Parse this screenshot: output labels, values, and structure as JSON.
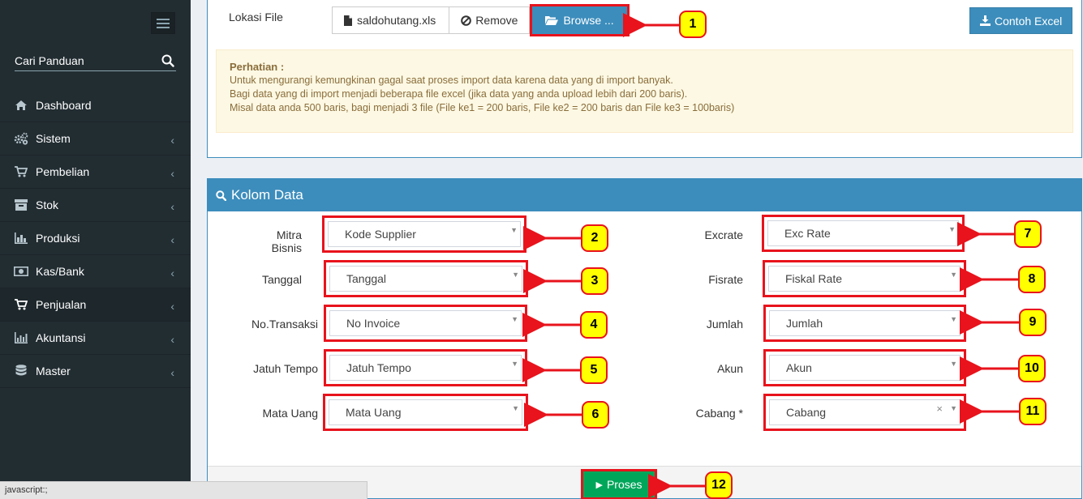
{
  "sidebar": {
    "search_placeholder": "Cari Panduan",
    "items": [
      {
        "label": "Dashboard",
        "icon": "home-icon"
      },
      {
        "label": "Sistem",
        "icon": "gears-icon"
      },
      {
        "label": "Pembelian",
        "icon": "cart-icon"
      },
      {
        "label": "Stok",
        "icon": "archive-icon"
      },
      {
        "label": "Produksi",
        "icon": "bar-chart-icon"
      },
      {
        "label": "Kas/Bank",
        "icon": "money-icon"
      },
      {
        "label": "Penjualan",
        "icon": "cart-icon"
      },
      {
        "label": "Akuntansi",
        "icon": "line-chart-icon"
      },
      {
        "label": "Master",
        "icon": "database-icon"
      }
    ]
  },
  "upload": {
    "label": "Lokasi File",
    "file_name": "saldohutang.xls",
    "remove_label": "Remove",
    "browse_label": "Browse ...",
    "contoh_label": "Contoh Excel"
  },
  "alert": {
    "title": "Perhatian :",
    "line1": "Untuk mengurangi kemungkinan gagal saat proses import data karena data yang di import banyak.",
    "line2": "Bagi data yang di import menjadi beberapa file excel (jika data yang anda upload lebih dari 200 baris).",
    "line3": "Misal data anda 500 baris, bagi menjadi 3 file (File ke1 = 200 baris, File ke2 = 200 baris dan File ke3 = 100baris)"
  },
  "kolom": {
    "title": "Kolom Data",
    "left": [
      {
        "label": "Mitra Bisnis",
        "value": "Kode Supplier",
        "num": "2"
      },
      {
        "label": "Tanggal",
        "value": "Tanggal",
        "num": "3"
      },
      {
        "label": "No.Transaksi",
        "value": "No Invoice",
        "num": "4"
      },
      {
        "label": "Jatuh Tempo",
        "value": "Jatuh Tempo",
        "num": "5"
      },
      {
        "label": "Mata Uang",
        "value": "Mata Uang",
        "num": "6"
      }
    ],
    "right": [
      {
        "label": "Excrate",
        "value": "Exc Rate",
        "num": "7"
      },
      {
        "label": "Fisrate",
        "value": "Fiskal Rate",
        "num": "8"
      },
      {
        "label": "Jumlah",
        "value": "Jumlah",
        "num": "9"
      },
      {
        "label": "Akun",
        "value": "Akun",
        "num": "10"
      },
      {
        "label": "Cabang *",
        "value": "Cabang",
        "num": "11"
      }
    ],
    "proses_label": "Proses"
  },
  "callouts": {
    "browse": "1",
    "proses": "12"
  },
  "status_bar": "javascript:;",
  "colors": {
    "primary": "#3c8dbc",
    "success": "#00a65a",
    "highlight": "#e8131c",
    "callout": "#ffff00",
    "sidebar": "#222d32"
  }
}
